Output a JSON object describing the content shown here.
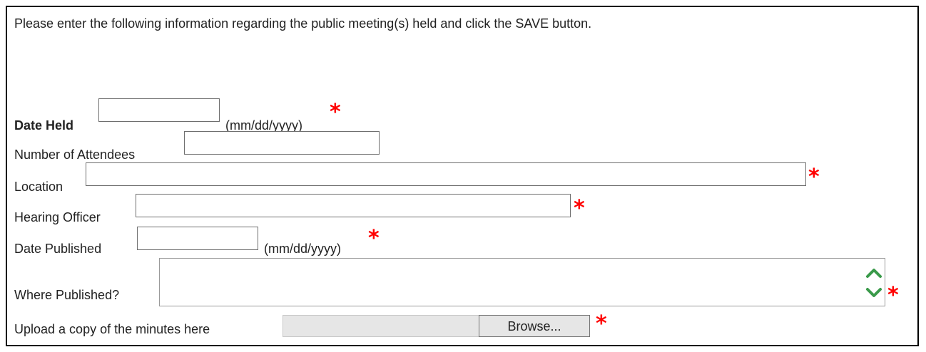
{
  "instructions": "Please enter the following information regarding the public meeting(s) held and click the SAVE button.",
  "form": {
    "date_held": {
      "label": "Date Held",
      "value": "",
      "hint": "(mm/dd/yyyy)",
      "required": "*"
    },
    "attendees": {
      "label": "Number of Attendees",
      "value": ""
    },
    "location": {
      "label": "Location",
      "value": "",
      "required": "*"
    },
    "hearing_officer": {
      "label": "Hearing Officer",
      "value": "",
      "required": "*"
    },
    "date_published": {
      "label": "Date Published",
      "value": "",
      "hint": "(mm/dd/yyyy)",
      "required": "*"
    },
    "where_published": {
      "label": "Where Published?",
      "value": "",
      "required": "*"
    },
    "upload": {
      "label": "Upload a copy of the minutes here",
      "button_label": "Browse...",
      "required": "*"
    }
  },
  "colors": {
    "required_marker": "#ff0000",
    "scroll_arrow": "#3a9a4a"
  },
  "icons": [
    "scroll-up-icon",
    "scroll-down-icon"
  ]
}
